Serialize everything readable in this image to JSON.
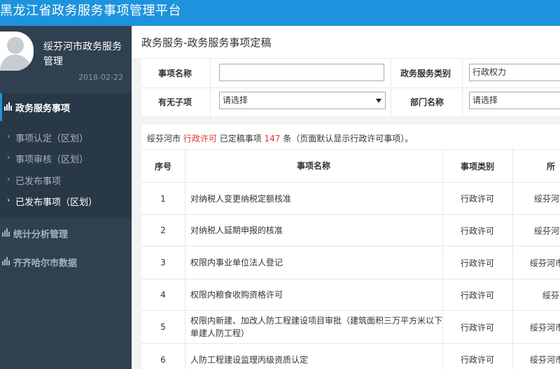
{
  "app_title": "黑龙江省政务服务事项管理平台",
  "user": {
    "name": "绥芬河市政务服务管理",
    "date": "2018-02-22"
  },
  "sidebar": {
    "menu_top": "政务服务事项",
    "sub_items": [
      {
        "label": "事项认定（区划）"
      },
      {
        "label": "事项审核（区划）"
      },
      {
        "label": "已发布事项"
      },
      {
        "label": "已发布事项（区划）"
      }
    ],
    "menu_items": [
      {
        "label": "统计分析管理"
      },
      {
        "label": "齐齐哈尔市数据"
      }
    ]
  },
  "page_title": "政务服务-政务服务事项定稿",
  "filter": {
    "item_name_label": "事项名称",
    "item_name_value": "",
    "service_type_label": "政务服务类别",
    "service_type_value": "行政权力",
    "has_child_label": "有无子项",
    "has_child_value": "请选择",
    "dept_label": "部门名称",
    "dept_value": "请选择"
  },
  "summary": {
    "city": "绥芬河市",
    "type": "行政许可",
    "mid": "已定稿事项",
    "count": "147",
    "tail": "条（页面默认显示行政许可事项）。"
  },
  "table": {
    "headers": [
      "序号",
      "事项名称",
      "事项类别",
      "所"
    ],
    "rows": [
      {
        "no": "1",
        "name": "对纳税人变更纳税定额核准",
        "type": "行政许可",
        "dept": "绥芬河市"
      },
      {
        "no": "2",
        "name": "对纳税人延期申报的核准",
        "type": "行政许可",
        "dept": "绥芬河市"
      },
      {
        "no": "3",
        "name": "权限内事业单位法人登记",
        "type": "行政许可",
        "dept": "绥芬河市机"
      },
      {
        "no": "4",
        "name": "权限内粮食收购资格许可",
        "type": "行政许可",
        "dept": "绥芬"
      },
      {
        "no": "5",
        "name": "权限内新建、加改人防工程建设项目审批（建筑面积三万平方米以下单建人防工程）",
        "type": "行政许可",
        "dept": "绥芬河市住"
      },
      {
        "no": "6",
        "name": "人防工程建设监理丙级资质认定",
        "type": "行政许可",
        "dept": "绥芬河市住"
      }
    ]
  }
}
